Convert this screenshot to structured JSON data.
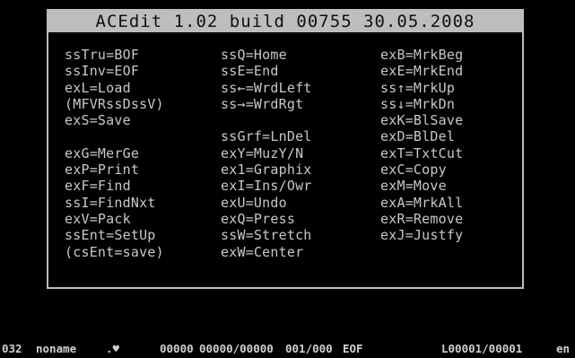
{
  "app": {
    "title": "ACEdit 1.02 build 00755 30.05.2008"
  },
  "help": {
    "col1": [
      "ssTru=BOF",
      "ssInv=EOF",
      "exL=Load",
      "(MFVRssDssV)",
      "exS=Save",
      "",
      "exG=MerGe",
      "exP=Print",
      "exF=Find",
      "ssI=FindNxt",
      "exV=Pack",
      "ssEnt=SetUp",
      "(csEnt=save)"
    ],
    "col2": [
      "ssQ=Home",
      "ssE=End",
      "ss←=WrdLeft",
      "ss→=WrdRgt",
      "",
      "ssGrf=LnDel",
      "exY=MuzY/N",
      "ex1=Graphix",
      "exI=Ins/Owr",
      "exU=Undo",
      "exQ=Press",
      "ssW=Stretch",
      "exW=Center"
    ],
    "col3": [
      "exB=MrkBeg",
      "exE=MrkEnd",
      "ss↑=MrkUp",
      "ss↓=MrkDn",
      "exK=BlSave",
      "exD=BlDel",
      "exT=TxtCut",
      "exC=Copy",
      "exM=Move",
      "exA=MrkAll",
      "exR=Remove",
      "exJ=Justfy",
      ""
    ]
  },
  "status": {
    "code": "032",
    "filename": "noname",
    "ext": ".♥",
    "counter": "00000",
    "position": "00000/00000",
    "page": "001/000",
    "eof": "EOF",
    "line": "L00001/00001",
    "lang": "en"
  },
  "colors": {
    "background": "#000000",
    "foreground": "#c8c8c8",
    "border": "#bdbdbd",
    "title_bg": "#bdbdbd",
    "title_fg": "#101010"
  }
}
